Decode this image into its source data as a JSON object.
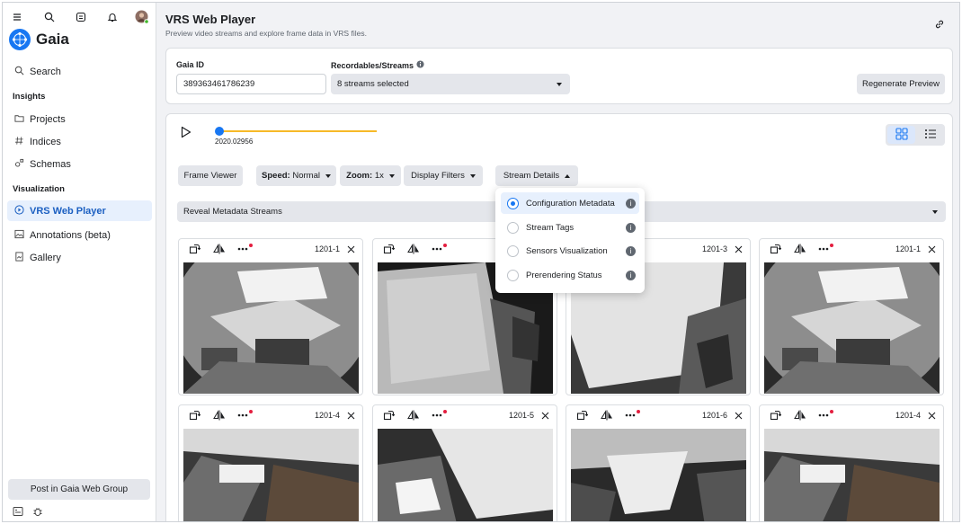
{
  "app": {
    "name": "Gaia"
  },
  "sidebar": {
    "search_label": "Search",
    "section_insights": "Insights",
    "section_visualization": "Visualization",
    "items_insights": [
      {
        "label": "Projects",
        "icon": "folder-icon"
      },
      {
        "label": "Indices",
        "icon": "hash-icon"
      },
      {
        "label": "Schemas",
        "icon": "schema-icon"
      }
    ],
    "items_visualization": [
      {
        "label": "VRS Web Player",
        "icon": "play-circle-icon",
        "active": true
      },
      {
        "label": "Annotations (beta)",
        "icon": "image-annotate-icon"
      },
      {
        "label": "Gallery",
        "icon": "gallery-icon"
      }
    ],
    "post_button": "Post in Gaia Web Group"
  },
  "page": {
    "title": "VRS Web Player",
    "subtitle": "Preview video streams and explore frame data in VRS files."
  },
  "form": {
    "gaia_id_label": "Gaia ID",
    "gaia_id_value": "389363461786239",
    "streams_label": "Recordables/Streams",
    "streams_value": "8 streams selected",
    "regenerate_label": "Regenerate Preview"
  },
  "player": {
    "timestamp": "2020.02956",
    "frame_viewer": "Frame Viewer",
    "speed_prefix": "Speed:",
    "speed_value": "Normal",
    "zoom_prefix": "Zoom:",
    "zoom_value": "1x",
    "display_filters": "Display Filters",
    "stream_details": "Stream Details",
    "reveal_metadata": "Reveal Metadata Streams"
  },
  "stream_details_menu": [
    {
      "label": "Configuration Metadata",
      "selected": true
    },
    {
      "label": "Stream Tags",
      "selected": false
    },
    {
      "label": "Sensors Visualization",
      "selected": false
    },
    {
      "label": "Prerendering Status",
      "selected": false
    }
  ],
  "tiles": [
    {
      "name": "1201-1"
    },
    {
      "name": ""
    },
    {
      "name": "1201-3"
    },
    {
      "name": "1201-1"
    },
    {
      "name": "1201-4"
    },
    {
      "name": "1201-5"
    },
    {
      "name": "1201-6"
    },
    {
      "name": "1201-4"
    }
  ],
  "colors": {
    "accent": "#1877f2",
    "timeline": "#f7b928",
    "notification_dot": "#e41e3f"
  }
}
